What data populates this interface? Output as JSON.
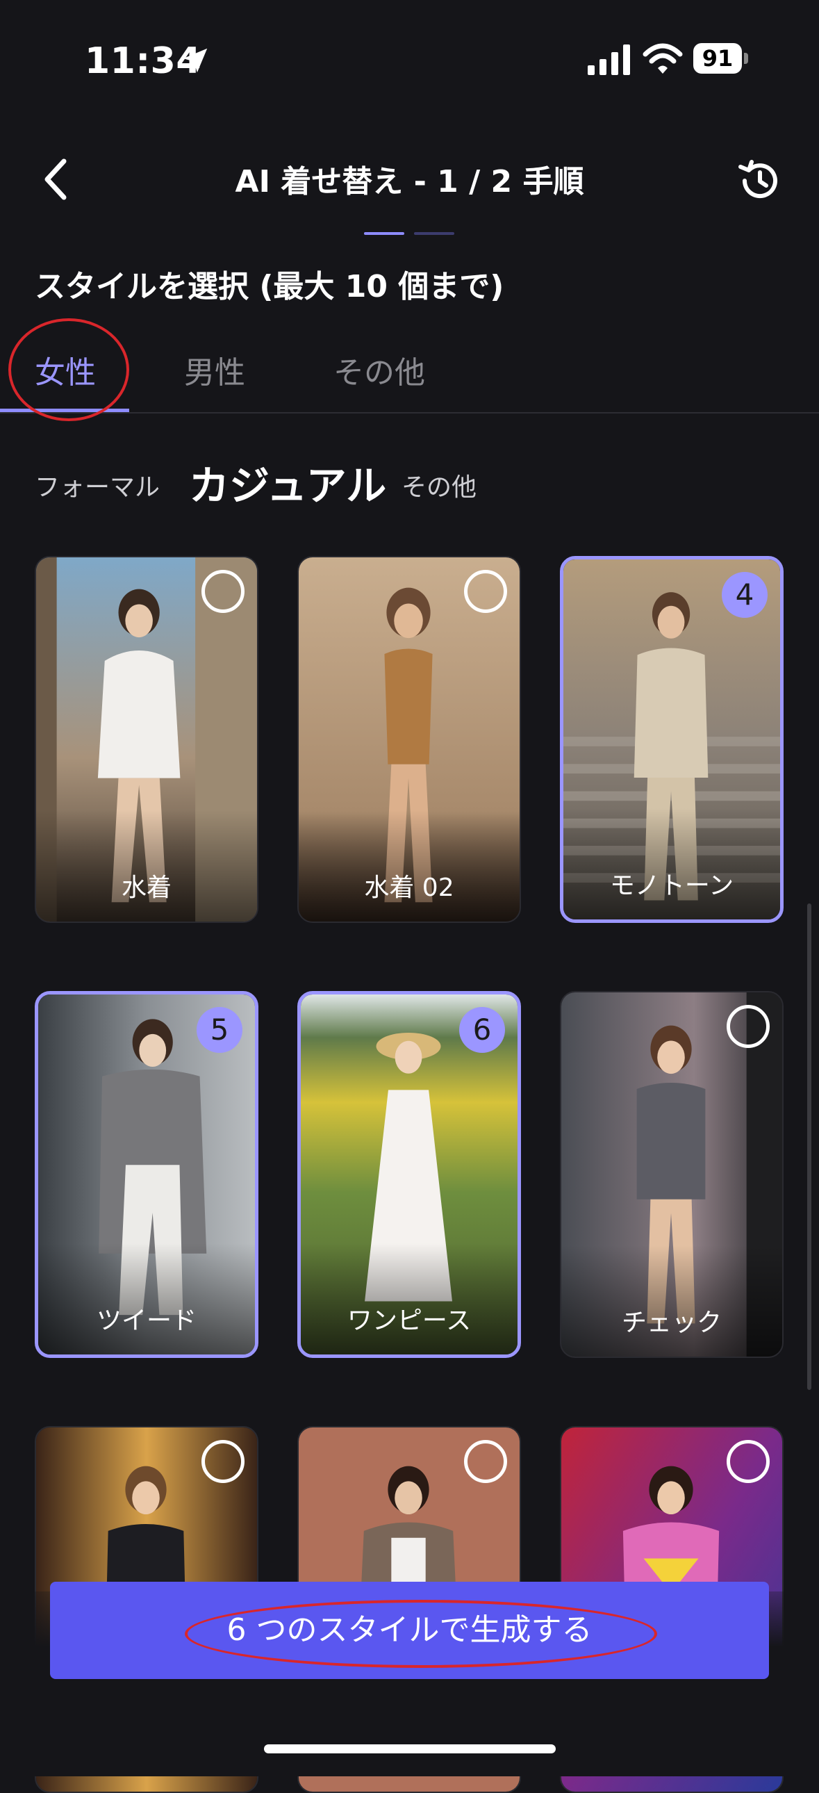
{
  "status_bar": {
    "time": "11:34",
    "battery": "91"
  },
  "header": {
    "title": "AI 着せ替え - 1 / 2 手順"
  },
  "subtitle": "スタイルを選択 (最大 10 個まで)",
  "gender_tabs": [
    {
      "label": "女性",
      "active": true
    },
    {
      "label": "男性",
      "active": false
    },
    {
      "label": "その他",
      "active": false
    }
  ],
  "categories": [
    {
      "label": "フォーマル",
      "active": false
    },
    {
      "label": "カジュアル",
      "active": true
    },
    {
      "label": "その他",
      "active": false
    }
  ],
  "styles": [
    {
      "label": "水着",
      "selected": false,
      "order": ""
    },
    {
      "label": "水着 02",
      "selected": false,
      "order": ""
    },
    {
      "label": "モノトーン",
      "selected": true,
      "order": "4"
    },
    {
      "label": "ツイード",
      "selected": true,
      "order": "5"
    },
    {
      "label": "ワンピース",
      "selected": true,
      "order": "6"
    },
    {
      "label": "チェック",
      "selected": false,
      "order": ""
    },
    {
      "label": "",
      "selected": false,
      "order": ""
    },
    {
      "label": "",
      "selected": false,
      "order": ""
    },
    {
      "label": "",
      "selected": false,
      "order": ""
    }
  ],
  "generate_button": {
    "label": "6 つのスタイルで生成する"
  },
  "colors": {
    "accent": "#9b96ff",
    "button": "#5a57f0",
    "background": "#151519",
    "annotation": "#d9262b"
  }
}
